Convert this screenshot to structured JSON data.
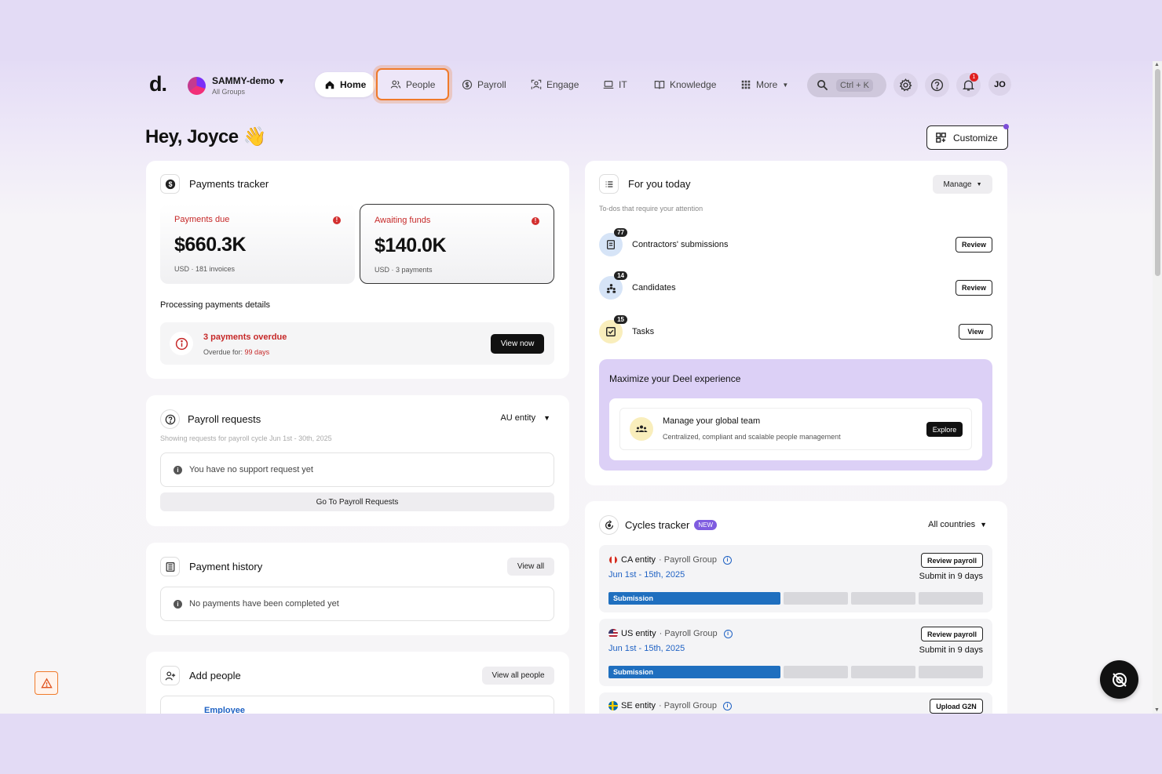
{
  "header": {
    "logo": "d.",
    "org_name": "SAMMY-demo",
    "org_sub": "All Groups",
    "nav": [
      {
        "label": "Home",
        "icon": "home-icon"
      },
      {
        "label": "People",
        "icon": "people-icon"
      },
      {
        "label": "Payroll",
        "icon": "dollar-icon"
      },
      {
        "label": "Engage",
        "icon": "engage-icon"
      },
      {
        "label": "IT",
        "icon": "laptop-icon"
      },
      {
        "label": "Knowledge",
        "icon": "book-icon"
      },
      {
        "label": "More",
        "icon": "grid-icon"
      }
    ],
    "search_shortcut": "Ctrl + K",
    "notif_count": "1",
    "user_initials": "JO"
  },
  "greeting": "Hey, Joyce 👋",
  "customize_label": "Customize",
  "payments_tracker": {
    "title": "Payments tracker",
    "due": {
      "label": "Payments due",
      "amount": "$660.3K",
      "meta": "USD · 181 invoices"
    },
    "awaiting": {
      "label": "Awaiting funds",
      "amount": "$140.0K",
      "meta": "USD · 3 payments"
    },
    "processing_label": "Processing payments details",
    "overdue_title": "3 payments overdue",
    "overdue_for_label": "Overdue for:",
    "overdue_days": "99 days",
    "view_now": "View now"
  },
  "payroll_requests": {
    "title": "Payroll requests",
    "entity": "AU entity",
    "showing": "Showing requests for payroll cycle Jun 1st - 30th, 2025",
    "empty": "You have no support request yet",
    "go_btn": "Go To Payroll Requests"
  },
  "payment_history": {
    "title": "Payment history",
    "view_all": "View all",
    "empty": "No payments have been completed yet"
  },
  "add_people": {
    "title": "Add people",
    "view_all": "View all people",
    "first_item": "Employee"
  },
  "for_you_today": {
    "title": "For you today",
    "manage": "Manage",
    "subtitle": "To-dos that require your attention",
    "items": [
      {
        "label": "Contractors' submissions",
        "count": "77",
        "action": "Review"
      },
      {
        "label": "Candidates",
        "count": "14",
        "action": "Review"
      },
      {
        "label": "Tasks",
        "count": "15",
        "action": "View"
      }
    ],
    "promo_title": "Maximize your Deel experience",
    "promo_item_title": "Manage your global team",
    "promo_item_desc": "Centralized, compliant and scalable people management",
    "promo_btn": "Explore"
  },
  "cycles_tracker": {
    "title": "Cycles tracker",
    "badge": "NEW",
    "filter": "All countries",
    "cycles": [
      {
        "entity": "CA entity",
        "group": "· Payroll Group",
        "dates": "Jun 1st - 15th, 2025",
        "due": "Submit in 9 days",
        "action": "Review payroll",
        "stage": "Submission"
      },
      {
        "entity": "US entity",
        "group": "· Payroll Group",
        "dates": "Jun 1st - 15th, 2025",
        "due": "Submit in 9 days",
        "action": "Review payroll",
        "stage": "Submission"
      },
      {
        "entity": "SE entity",
        "group": "· Payroll Group",
        "dates": "",
        "due": "",
        "action": "Upload G2N",
        "stage": ""
      }
    ]
  }
}
